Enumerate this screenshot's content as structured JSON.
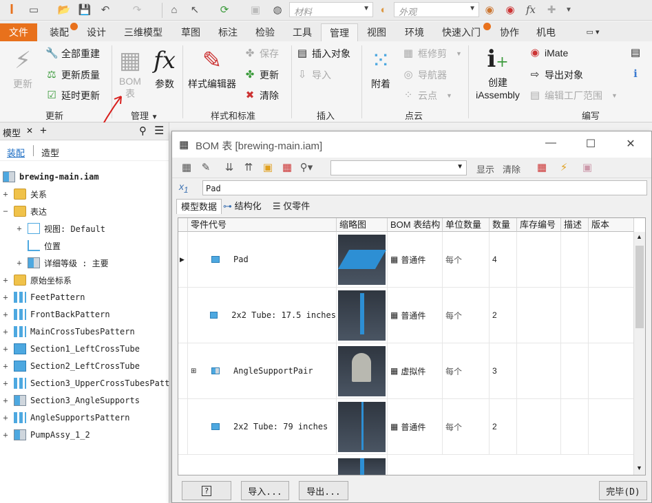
{
  "qat": {
    "material_placeholder": "材料",
    "appearance_placeholder": "外观",
    "fx_label": "fx"
  },
  "tabs": [
    {
      "label": "文件"
    },
    {
      "label": "装配"
    },
    {
      "label": "设计"
    },
    {
      "label": "三维模型"
    },
    {
      "label": "草图"
    },
    {
      "label": "标注"
    },
    {
      "label": "检验"
    },
    {
      "label": "工具"
    },
    {
      "label": "管理"
    },
    {
      "label": "视图"
    },
    {
      "label": "环境"
    },
    {
      "label": "快速入门"
    },
    {
      "label": "协作"
    },
    {
      "label": "机电"
    }
  ],
  "ribbon": {
    "update_panel": {
      "update": "更新",
      "rebuild_all": "全部重建",
      "update_mass": "更新质量",
      "defer_update": "延时更新",
      "label": "更新"
    },
    "manage_panel": {
      "bom_line1": "BOM",
      "bom_line2": "表",
      "params": "参数",
      "label": "管理"
    },
    "styles_panel": {
      "style_editor": "样式编辑器",
      "save": "保存",
      "update": "更新",
      "purge": "清除",
      "label": "样式和标准"
    },
    "insert_panel": {
      "insert_object": "插入对象",
      "import": "导入",
      "label": "插入"
    },
    "pointcloud_panel": {
      "attach": "附着",
      "trim": "框修剪",
      "navigator": "导航器",
      "points": "云点",
      "label": "点云"
    },
    "author_panel": {
      "create_line1": "创建",
      "create_line2": "iAssembly",
      "imate": "iMate",
      "export_object": "导出对象",
      "edit_factory": "编辑工厂范围",
      "label": "编写"
    }
  },
  "browser": {
    "tab_label": "模型",
    "close": "✕",
    "add": "+",
    "mode_assembly": "装配",
    "mode_modeling": "造型",
    "items": [
      {
        "label": "brewing-main.iam"
      },
      {
        "label": "关系"
      },
      {
        "label": "表达"
      },
      {
        "label": "视图: Default"
      },
      {
        "label": "位置"
      },
      {
        "label": "详细等级 : 主要"
      },
      {
        "label": "原始坐标系"
      },
      {
        "label": "FeetPattern"
      },
      {
        "label": "FrontBackPattern"
      },
      {
        "label": "MainCrossTubesPattern"
      },
      {
        "label": "Section1_LeftCrossTube"
      },
      {
        "label": "Section2_LeftCrossTube"
      },
      {
        "label": "Section3_UpperCrossTubesPatt"
      },
      {
        "label": "Section3_AngleSupports"
      },
      {
        "label": "AngleSupportsPattern"
      },
      {
        "label": "PumpAssy_1_2"
      }
    ]
  },
  "dialog": {
    "title": "BOM 表 [brewing-main.iam]",
    "toolbar_show": "显示",
    "toolbar_clear": "清除",
    "formula_value": "Pad",
    "tabs": [
      "模型数据",
      "结构化",
      "仅零件"
    ],
    "columns": [
      "零件代号",
      "缩略图",
      "BOM 表结构",
      "单位数量",
      "数量",
      "库存编号",
      "描述",
      "版本"
    ],
    "rows": [
      {
        "part": "Pad",
        "structure": "普通件",
        "unit": "每个",
        "qty": "4"
      },
      {
        "part": "2x2 Tube: 17.5 inches",
        "structure": "普通件",
        "unit": "每个",
        "qty": "2"
      },
      {
        "part": "AngleSupportPair",
        "structure": "虚拟件",
        "unit": "每个",
        "qty": "3"
      },
      {
        "part": "2x2 Tube: 79 inches",
        "structure": "普通件",
        "unit": "每个",
        "qty": "2"
      }
    ],
    "btn_help": "?",
    "btn_import": "导入...",
    "btn_export": "导出...",
    "btn_done": "完毕(D)"
  }
}
